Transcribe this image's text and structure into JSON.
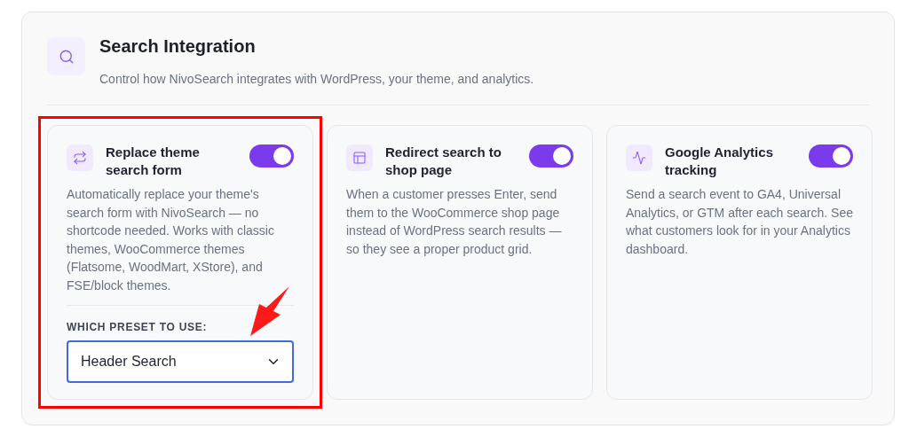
{
  "section": {
    "title": "Search Integration",
    "description": "Control how NivoSearch integrates with WordPress, your theme, and analytics."
  },
  "cards": [
    {
      "title": "Replace theme search form",
      "on": true,
      "highlighted": true,
      "description": "Automatically replace your theme's search form with NivoSearch — no shortcode needed. Works with classic themes, WooCommerce themes (Flatsome, WoodMart, XStore), and FSE/block themes.",
      "preset": {
        "label": "WHICH PRESET TO USE:",
        "value": "Header Search"
      }
    },
    {
      "title": "Redirect search to shop page",
      "on": true,
      "highlighted": false,
      "description": "When a customer presses Enter, send them to the WooCommerce shop page instead of WordPress search results — so they see a proper product grid."
    },
    {
      "title": "Google Analytics tracking",
      "on": true,
      "highlighted": false,
      "description": "Send a search event to GA4, Universal Analytics, or GTM after each search. See what customers look for in your Analytics dashboard."
    }
  ]
}
